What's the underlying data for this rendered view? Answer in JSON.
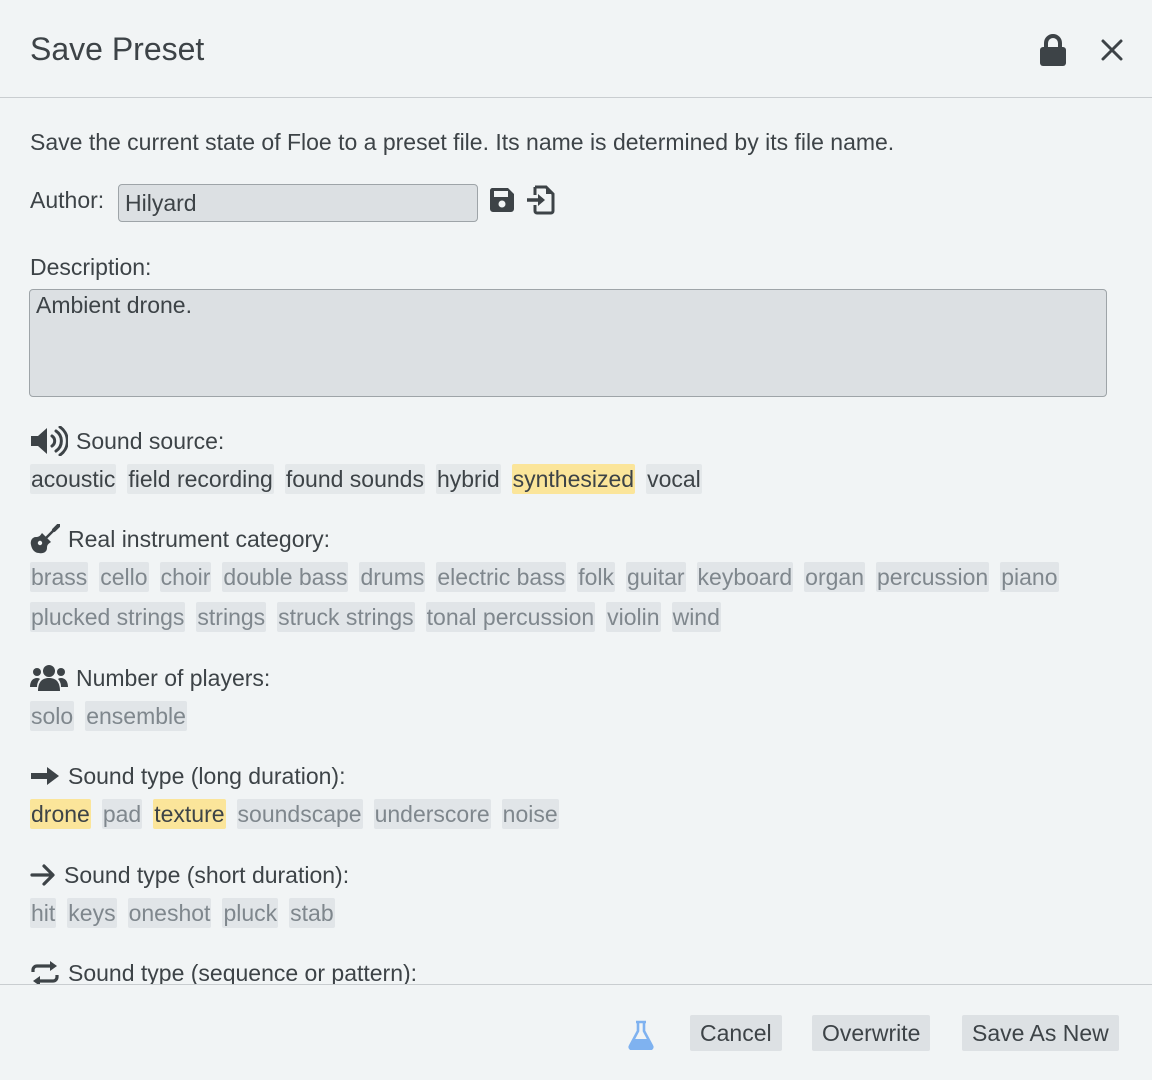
{
  "dialog": {
    "title": "Save Preset"
  },
  "intro": "Save the current state of Floe to a preset file. Its name is determined by its file name.",
  "author": {
    "label": "Author:",
    "value": "Hilyard"
  },
  "description": {
    "label": "Description:",
    "value": "Ambient drone."
  },
  "sections": {
    "sound_source": {
      "label": "Sound source:",
      "tags": [
        {
          "text": "acoustic",
          "selected": false
        },
        {
          "text": "field recording",
          "selected": false
        },
        {
          "text": "found sounds",
          "selected": false
        },
        {
          "text": "hybrid",
          "selected": false
        },
        {
          "text": "synthesized",
          "selected": true
        },
        {
          "text": "vocal",
          "selected": false
        }
      ]
    },
    "instrument": {
      "label": "Real instrument category:",
      "tags": [
        {
          "text": "brass",
          "selected": false
        },
        {
          "text": "cello",
          "selected": false
        },
        {
          "text": "choir",
          "selected": false
        },
        {
          "text": "double bass",
          "selected": false
        },
        {
          "text": "drums",
          "selected": false
        },
        {
          "text": "electric bass",
          "selected": false
        },
        {
          "text": "folk",
          "selected": false
        },
        {
          "text": "guitar",
          "selected": false
        },
        {
          "text": "keyboard",
          "selected": false
        },
        {
          "text": "organ",
          "selected": false
        },
        {
          "text": "percussion",
          "selected": false
        },
        {
          "text": "piano",
          "selected": false
        },
        {
          "text": "plucked strings",
          "selected": false
        },
        {
          "text": "strings",
          "selected": false
        },
        {
          "text": "struck strings",
          "selected": false
        },
        {
          "text": "tonal percussion",
          "selected": false
        },
        {
          "text": "violin",
          "selected": false
        },
        {
          "text": "wind",
          "selected": false
        }
      ]
    },
    "players": {
      "label": "Number of players:",
      "tags": [
        {
          "text": "solo",
          "selected": false
        },
        {
          "text": "ensemble",
          "selected": false
        }
      ]
    },
    "long_type": {
      "label": "Sound type (long duration):",
      "tags": [
        {
          "text": "drone",
          "selected": true
        },
        {
          "text": "pad",
          "selected": false
        },
        {
          "text": "texture",
          "selected": true
        },
        {
          "text": "soundscape",
          "selected": false
        },
        {
          "text": "underscore",
          "selected": false
        },
        {
          "text": "noise",
          "selected": false
        }
      ]
    },
    "short_type": {
      "label": "Sound type (short duration):",
      "tags": [
        {
          "text": "hit",
          "selected": false
        },
        {
          "text": "keys",
          "selected": false
        },
        {
          "text": "oneshot",
          "selected": false
        },
        {
          "text": "pluck",
          "selected": false
        },
        {
          "text": "stab",
          "selected": false
        }
      ]
    },
    "sequence_type": {
      "label": "Sound type (sequence or pattern):"
    }
  },
  "footer": {
    "cancel": "Cancel",
    "overwrite": "Overwrite",
    "save_new": "Save As New"
  },
  "colors": {
    "selected_tag": "#fbe59a",
    "tag_bg": "#e1e5e8",
    "accent_flask": "#7fb2f0"
  }
}
